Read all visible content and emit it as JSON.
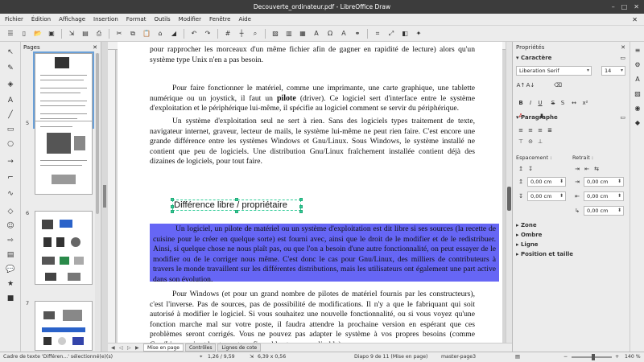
{
  "window": {
    "title": "Decouverte_ordinateur.pdf - LibreOffice Draw"
  },
  "menu": [
    "Fichier",
    "Édition",
    "Affichage",
    "Insertion",
    "Format",
    "Outils",
    "Modifier",
    "Fenêtre",
    "Aide"
  ],
  "pages_panel": {
    "title": "Pages",
    "thumbs": [
      {
        "num": ""
      },
      {
        "num": "5"
      },
      {
        "num": "6"
      },
      {
        "num": "7"
      }
    ]
  },
  "document": {
    "p1": "pour rapprocher les morceaux d'un même fichier afin de gagner en rapidité de lecture) alors qu'un système type Unix n'en a pas besoin.",
    "p2a": "Pour faire fonctionner le matériel, comme une imprimante, une carte graphique, une tablette numérique ou un joystick, il faut un ",
    "p2b": "pilote",
    "p2c": " (driver). Ce logiciel sert d'interface entre le système d'exploitation et le périphérique lui-même, il spécifie au logiciel comment se servir du périphérique.",
    "p3": "Un système d'exploitation seul ne sert à rien. Sans des logiciels types traitement de texte, navigateur internet, graveur, lecteur de mails, le système lui-même ne peut rien faire. C'est encore une grande différence entre les systèmes Windows et Gnu/Linux. Sous Windows, le système installé ne contient que peu de logiciels. Une distribution Gnu/Linux fraîchement installée contient déjà des dizaines de logiciels, pour tout faire.",
    "heading": "Différence libre / propriétaire",
    "p4": "Un logiciel, un pilote de matériel ou un système d'exploitation est dit libre si ses sources (la recette de cuisine pour le créer en quelque sorte) est fourni avec, ainsi que le droit de le modifier et de le redistribuer. Ainsi, si quelque chose ne nous plaît pas, ou que l'on a besoin d'une autre fonctionnalité, on peut essayer de le modifier ou de le corriger nous même. C'est donc le cas pour Gnu/Linux, des milliers de contributeurs à travers le monde travaillent sur les différentes distributions, mais les utilisateurs ont également une part active dans son évolution.",
    "p5": "Pour Windows (et pour un grand nombre de pilotes de matériel fournis par les constructeurs), c'est l'inverse. Pas de sources, pas de possibilité de modifications. Il n'y a que le fabriquant qui soit autorisé à modifier le logiciel. Si vous souhaitez une nouvelle fonctionnalité, ou si vous voyez qu'une fonction marche mal sur votre poste, il faudra attendre la prochaine version en espérant que ces problèmes seront corrigés. Vous ne pouvez pas adapter le système à vos propres besoins (comme Gnu/Linux qui est hautement configurable et personnalisable)."
  },
  "tabs": [
    "Mise en page",
    "Contrôles",
    "Lignes de cote"
  ],
  "properties": {
    "title": "Propriétés",
    "caractere": "Caractère",
    "font_name": "Liberation Serif",
    "font_size": "14",
    "paragraphe": "Paragraphe",
    "espacement": "Espacement :",
    "retrait": "Retrait :",
    "sp_above": "0,00 cm",
    "sp_below": "0,00 cm",
    "ind_before": "0,00 cm",
    "ind_after": "0,00 cm",
    "ind_first": "0,00 cm",
    "zone": "Zone",
    "ombre": "Ombre",
    "ligne": "Ligne",
    "position": "Position et taille"
  },
  "status": {
    "selection": "Cadre de texte 'Différen...' sélectionné(e)(s)",
    "position": "1,26 / 9,59",
    "size": "6,39 x 0,56",
    "slide": "Diapo 9 de 11 (Mise en page)",
    "master": "master-page3",
    "zoom": "140 %"
  }
}
